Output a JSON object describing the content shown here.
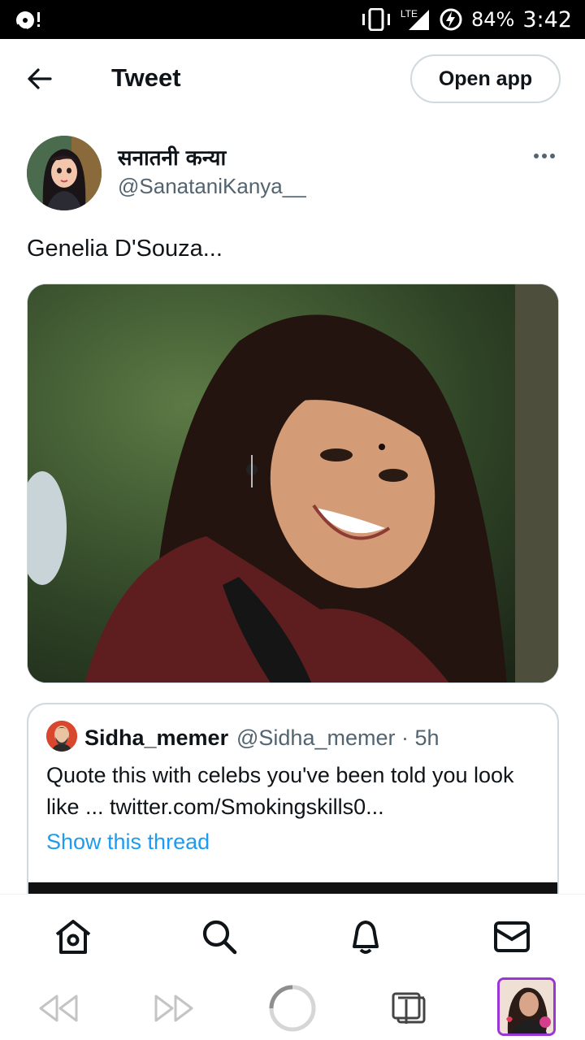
{
  "status_bar": {
    "network": "LTE",
    "battery": "84%",
    "time": "3:42",
    "icons": [
      "media-icon",
      "vibrate-icon",
      "signal-icon",
      "battery-charging-icon"
    ]
  },
  "header": {
    "back_icon": "arrow-left-icon",
    "title": "Tweet",
    "open_app_label": "Open app"
  },
  "tweet": {
    "author_name": "सनातनी कन्या",
    "author_handle": "@SanataniKanya__",
    "more_icon": "more-horizontal-icon",
    "text": "Genelia D'Souza..."
  },
  "quote": {
    "name": "Sidha_memer",
    "meta": "@Sidha_memer · 5h",
    "text": "Quote this with celebs you've been told you look like ...  twitter.com/Smokingskills0...",
    "link": "Show this thread"
  },
  "bottom_nav": {
    "items": [
      {
        "name": "home",
        "icon": "home-icon"
      },
      {
        "name": "search",
        "icon": "search-icon"
      },
      {
        "name": "notifications",
        "icon": "bell-icon"
      },
      {
        "name": "messages",
        "icon": "mail-icon"
      }
    ]
  },
  "browser_bar": {
    "items": [
      "rewind-icon",
      "fast-forward-icon",
      "loading-spinner-icon",
      "tabs-icon",
      "tab-thumbnail"
    ]
  },
  "colors": {
    "accent": "#1d9bf0",
    "text": "#0f1419",
    "secondary_text": "#536471",
    "border": "#cfd9de",
    "thumb_border": "#9a36d6"
  }
}
